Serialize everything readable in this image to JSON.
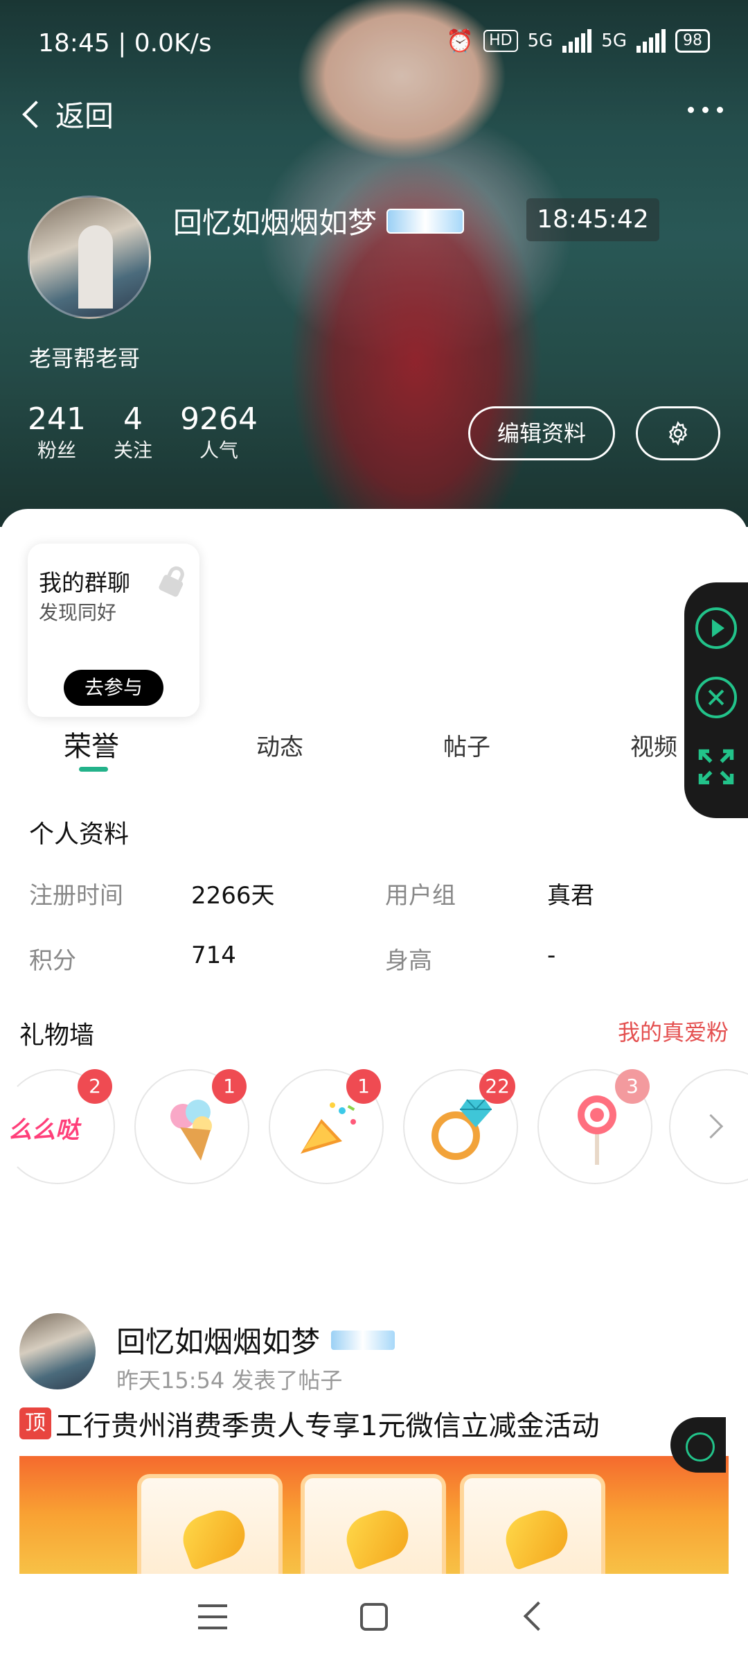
{
  "status_bar": {
    "time": "18:45 | 0.0K/s",
    "hd": "HD",
    "net1": "5G",
    "net2": "5G",
    "battery": "98"
  },
  "nav": {
    "back_label": "返回"
  },
  "profile": {
    "username": "回忆如烟烟如梦",
    "clock": "18:45:42",
    "nickname": "老哥帮老哥",
    "stats": [
      {
        "value": "241",
        "label": "粉丝"
      },
      {
        "value": "4",
        "label": "关注"
      },
      {
        "value": "9264",
        "label": "人气"
      }
    ],
    "edit_label": "编辑资料"
  },
  "group_card": {
    "title": "我的群聊",
    "subtitle": "发现同好",
    "join_label": "去参与"
  },
  "tabs": [
    {
      "label": "荣誉",
      "active": true
    },
    {
      "label": "动态"
    },
    {
      "label": "帖子"
    },
    {
      "label": "视频"
    }
  ],
  "personal_info": {
    "title": "个人资料",
    "register_key": "注册时间",
    "register_val": "2266天",
    "group_key": "用户组",
    "group_val": "真君",
    "points_key": "积分",
    "points_val": "714",
    "height_key": "身高",
    "height_val": "-"
  },
  "gift_wall": {
    "title": "礼物墙",
    "link": "我的真爱粉",
    "gifts": [
      {
        "icon": "text-badge-gift-icon",
        "count": "2",
        "label": "么么哒"
      },
      {
        "icon": "ice-cream-icon",
        "count": "1"
      },
      {
        "icon": "party-popper-icon",
        "count": "1"
      },
      {
        "icon": "diamond-ring-icon",
        "count": "22"
      },
      {
        "icon": "lollipop-icon",
        "count": "3"
      }
    ]
  },
  "post": {
    "author": "回忆如烟烟如梦",
    "meta": "昨天15:54 发表了帖子",
    "tag": "顶",
    "title": "工行贵州消费季贵人专享1元微信立减金活动"
  },
  "colors": {
    "accent": "#23b28a",
    "link_red": "#e45050",
    "badge_red": "#ef4b52"
  }
}
